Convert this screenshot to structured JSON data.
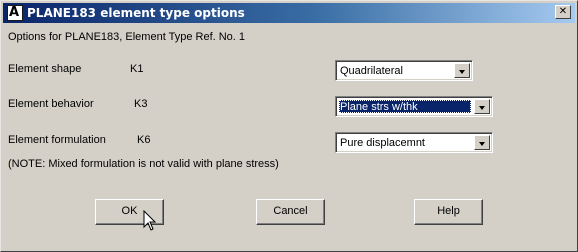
{
  "window": {
    "title": "PLANE183 element type options",
    "icon_letter": "A",
    "close_glyph": "✕"
  },
  "header_text": "Options for PLANE183, Element Type Ref. No. 1",
  "options": [
    {
      "label": "Element shape",
      "key": "K1",
      "value": "Quadrilateral"
    },
    {
      "label": "Element behavior",
      "key": "K3",
      "value": "Plane strs w/thk"
    },
    {
      "label": "Element formulation",
      "key": "K6",
      "value": "Pure displacemnt"
    }
  ],
  "note": "(NOTE: Mixed formulation is not valid with plane stress)",
  "buttons": {
    "ok": "OK",
    "cancel": "Cancel",
    "help": "Help"
  },
  "icons": {
    "app": "ansys-app-icon",
    "close": "close-icon",
    "dropdown": "dropdown-arrow-icon",
    "cursor": "mouse-pointer-icon"
  },
  "colors": {
    "titlebar_start": "#0a246a",
    "titlebar_end": "#a6caf0",
    "selection": "#0a246a",
    "face": "#d4d0c8"
  }
}
